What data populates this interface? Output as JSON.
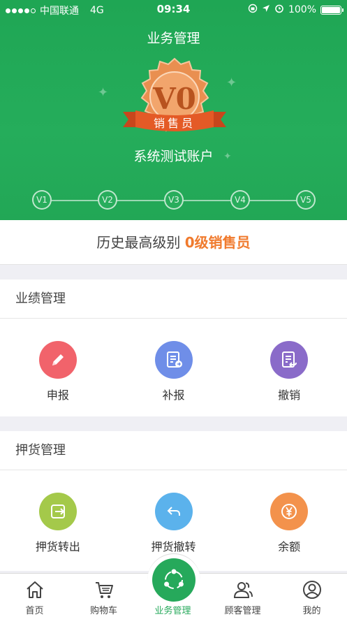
{
  "status_bar": {
    "carrier": "中国联通",
    "network": "4G",
    "time": "09:34",
    "battery": "100%",
    "battery_level": 1.0
  },
  "header": {
    "title": "业务管理"
  },
  "badge": {
    "level_code": "V0",
    "level_name": "销售员",
    "colors": {
      "medal": "#e98f50",
      "ribbon": "#e45a26"
    }
  },
  "account": {
    "name": "系统测试账户"
  },
  "levels": [
    "V1",
    "V2",
    "V3",
    "V4",
    "V5"
  ],
  "history": {
    "prefix": "历史最高级别",
    "value": "0级销售员",
    "accent": "#f07a2d"
  },
  "performance": {
    "title": "业绩管理",
    "items": [
      {
        "label": "申报",
        "icon": "pencil-icon",
        "color": "#f1636b"
      },
      {
        "label": "补报",
        "icon": "document-arrow-icon",
        "color": "#6f8ee8"
      },
      {
        "label": "撤销",
        "icon": "document-undo-icon",
        "color": "#8a6bc9"
      }
    ]
  },
  "deposit": {
    "title": "押货管理",
    "items": [
      {
        "label": "押货转出",
        "icon": "export-icon",
        "color": "#a4c94a"
      },
      {
        "label": "押货撤转",
        "icon": "reply-icon",
        "color": "#5bb2ec"
      },
      {
        "label": "余额",
        "icon": "yen-icon",
        "color": "#f3924c"
      }
    ]
  },
  "tabbar": {
    "items": [
      {
        "label": "首页",
        "icon": "home-icon"
      },
      {
        "label": "购物车",
        "icon": "cart-icon"
      },
      {
        "label": "业务管理",
        "icon": "share-icon",
        "active": true
      },
      {
        "label": "顾客管理",
        "icon": "customers-icon"
      },
      {
        "label": "我的",
        "icon": "profile-icon"
      }
    ],
    "active_color": "#26a95b"
  }
}
